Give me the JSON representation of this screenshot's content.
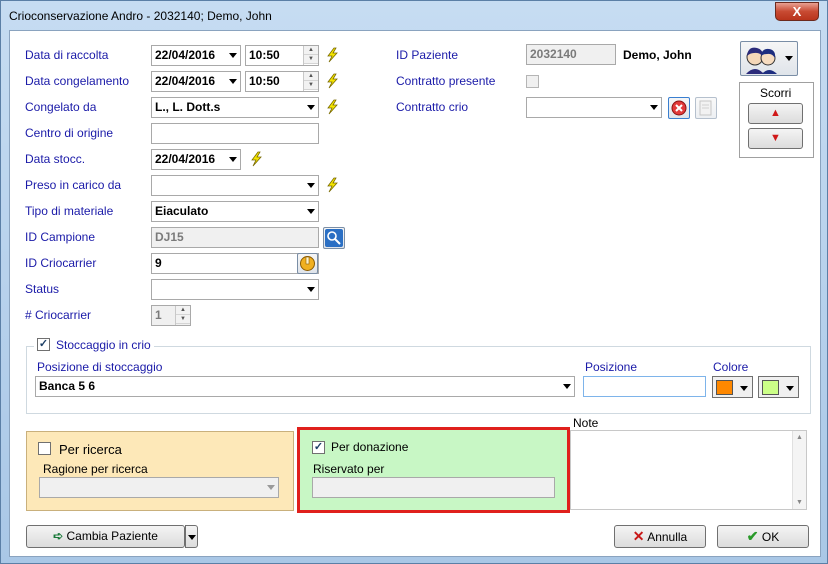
{
  "window": {
    "title": "Crioconservazione Andro   - 2032140; Demo, John",
    "close_label": "X"
  },
  "fields": {
    "data_raccolta": {
      "label": "Data di raccolta",
      "date": "22/04/2016",
      "time": "10:50"
    },
    "data_congelamento": {
      "label": "Data congelamento",
      "date": "22/04/2016",
      "time": "10:50"
    },
    "congelato_da": {
      "label": "Congelato da",
      "value": "L., L. Dott.s"
    },
    "centro_origine": {
      "label": "Centro di origine",
      "value": ""
    },
    "data_stocc": {
      "label": "Data stocc.",
      "date": "22/04/2016"
    },
    "preso_in_carico": {
      "label": "Preso in carico da",
      "value": ""
    },
    "tipo_materiale": {
      "label": "Tipo di materiale",
      "value": "Eiaculato"
    },
    "id_campione": {
      "label": "ID Campione",
      "value": "DJ15"
    },
    "id_criocarrier": {
      "label": "ID Criocarrier",
      "value": "9"
    },
    "status": {
      "label": "Status",
      "value": ""
    },
    "num_criocarrier": {
      "label": "# Criocarrier",
      "value": "1"
    }
  },
  "patient": {
    "id_label": "ID Paziente",
    "id_value": "2032140",
    "name": "Demo, John",
    "contratto_presente_label": "Contratto presente",
    "contratto_presente_checked": false,
    "contratto_crio_label": "Contratto crio",
    "contratto_crio_value": ""
  },
  "scroll": {
    "label": "Scorri",
    "up_glyph": "▲",
    "down_glyph": "▼"
  },
  "storage": {
    "checkbox_label": "Stoccaggio in crio",
    "checked": true,
    "posizione_stoccaggio_label": "Posizione di stoccaggio",
    "posizione_stoccaggio_value": "Banca 5 6",
    "posizione_label": "Posizione",
    "posizione_value": "",
    "colore_label": "Colore",
    "color_1": "#ff8800",
    "color_2": "#ccff88"
  },
  "ricerca": {
    "checkbox_label": "Per ricerca",
    "checked": false,
    "ragione_label": "Ragione per ricerca",
    "ragione_value": ""
  },
  "donazione": {
    "checkbox_label": "Per donazione",
    "checked": true,
    "riservato_label": "Riservato per",
    "riservato_value": ""
  },
  "note": {
    "label": "Note",
    "value": ""
  },
  "buttons": {
    "cambia_paziente": "Cambia Paziente",
    "annulla": "Annulla",
    "ok": "OK"
  },
  "glyphs": {
    "check": "✓",
    "up_small": "▲",
    "down_small": "▼"
  }
}
